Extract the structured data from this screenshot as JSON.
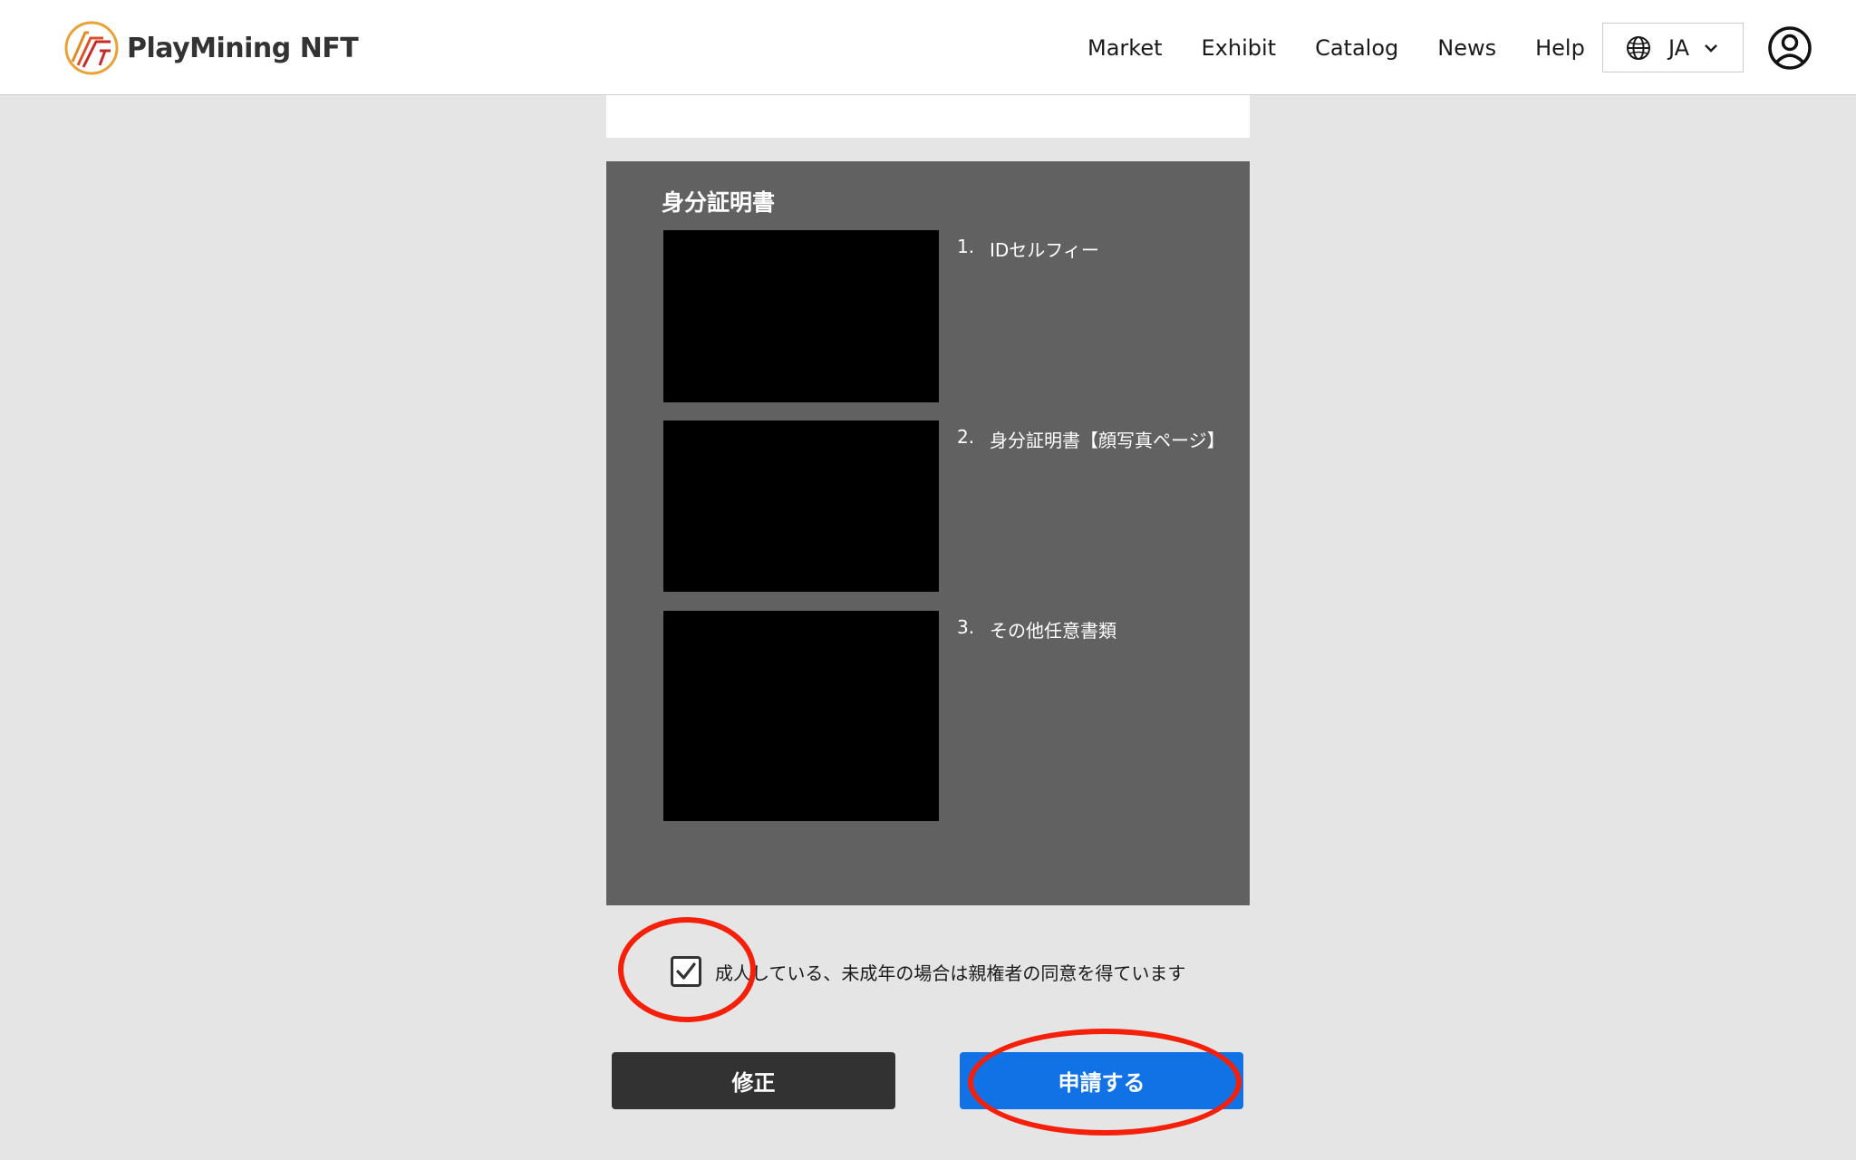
{
  "header": {
    "logo_text": "PlayMining NFT",
    "nav": [
      "Market",
      "Exhibit",
      "Catalog",
      "News",
      "Help"
    ],
    "language": "JA",
    "icons": {
      "language": "globe-icon",
      "language_toggle": "chevron-down-icon",
      "account": "user-circle-icon"
    }
  },
  "id_documents": {
    "title": "身分証明書",
    "items": [
      {
        "number": "1.",
        "label": "IDセルフィー"
      },
      {
        "number": "2.",
        "label": "身分証明書【顔写真ページ】"
      },
      {
        "number": "3.",
        "label": "その他任意書類"
      }
    ]
  },
  "consent": {
    "checked": true,
    "label": "成人している、未成年の場合は親権者の同意を得ています"
  },
  "actions": {
    "edit_label": "修正",
    "submit_label": "申請する"
  },
  "colors": {
    "primary": "#1072e5",
    "dark_button": "#323232",
    "panel": "#616161",
    "annotation": "#f5200a"
  }
}
